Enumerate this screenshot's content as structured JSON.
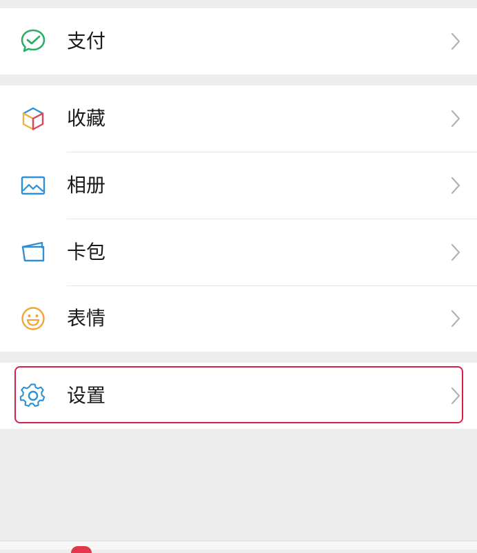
{
  "menu": {
    "pay": {
      "label": "支付",
      "icon": "pay-check-icon",
      "color": "#2aae67"
    },
    "favorites": {
      "label": "收藏",
      "icon": "cube-icon"
    },
    "album": {
      "label": "相册",
      "icon": "image-icon",
      "color": "#2e8fd6"
    },
    "cards": {
      "label": "卡包",
      "icon": "wallet-icon",
      "color": "#2e8fd6"
    },
    "stickers": {
      "label": "表情",
      "icon": "smiley-icon",
      "color": "#f0a43a"
    },
    "settings": {
      "label": "设置",
      "icon": "gear-icon",
      "color": "#2e8fd6"
    }
  },
  "colors": {
    "background": "#ededed",
    "highlight_border": "#d6204a",
    "chevron": "#b2b2b2"
  }
}
